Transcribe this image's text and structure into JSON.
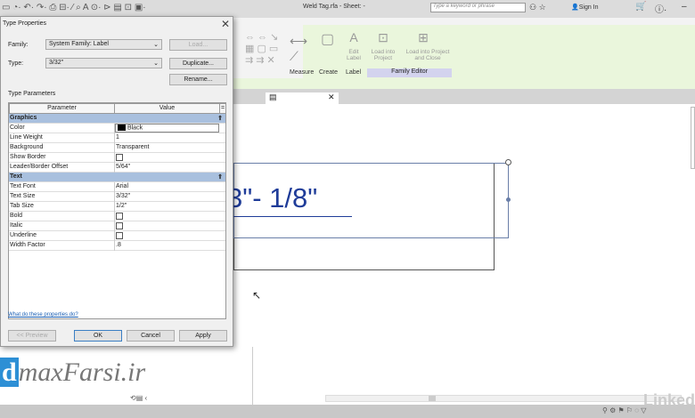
{
  "app": {
    "title": "Weld Tag.rfa - Sheet: -",
    "search_placeholder": "Type a keyword or phrase",
    "sign_in": "Sign In"
  },
  "ribbon": {
    "panels": [
      "Measure",
      "Create",
      "Label"
    ],
    "buttons": {
      "edit_label": "Edit Label",
      "load_into_project": "Load into Project",
      "load_close": "Load into Project and Close"
    },
    "family_editor": "Family Editor"
  },
  "dialog": {
    "title": "Type Properties",
    "family_label": "Family:",
    "family_value": "System Family: Label",
    "type_label": "Type:",
    "type_value": "3/32\"",
    "load": "Load...",
    "duplicate": "Duplicate...",
    "rename": "Rename...",
    "type_parameters": "Type Parameters",
    "col_parameter": "Parameter",
    "col_value": "Value",
    "groups": [
      {
        "name": "Graphics",
        "rows": [
          {
            "p": "Color",
            "v": "Black",
            "kind": "color"
          },
          {
            "p": "Line Weight",
            "v": "1"
          },
          {
            "p": "Background",
            "v": "Transparent"
          },
          {
            "p": "Show Border",
            "v": "",
            "kind": "checkbox",
            "checked": false
          },
          {
            "p": "Leader/Border Offset",
            "v": "5/64\""
          }
        ]
      },
      {
        "name": "Text",
        "rows": [
          {
            "p": "Text Font",
            "v": "Arial"
          },
          {
            "p": "Text Size",
            "v": "3/32\""
          },
          {
            "p": "Tab Size",
            "v": "1/2\""
          },
          {
            "p": "Bold",
            "v": "",
            "kind": "checkbox",
            "checked": false
          },
          {
            "p": "Italic",
            "v": "",
            "kind": "checkbox",
            "checked": false
          },
          {
            "p": "Underline",
            "v": "",
            "kind": "checkbox",
            "checked": false
          },
          {
            "p": "Width Factor",
            "v": ".8"
          }
        ]
      }
    ],
    "help_link": "What do these properties do?",
    "preview": "<< Preview",
    "ok": "OK",
    "cancel": "Cancel",
    "apply": "Apply"
  },
  "canvas": {
    "label_text": "3\"- 1/8\""
  },
  "watermark": "dmaxFarsi.ir",
  "linkedin": "Linked"
}
